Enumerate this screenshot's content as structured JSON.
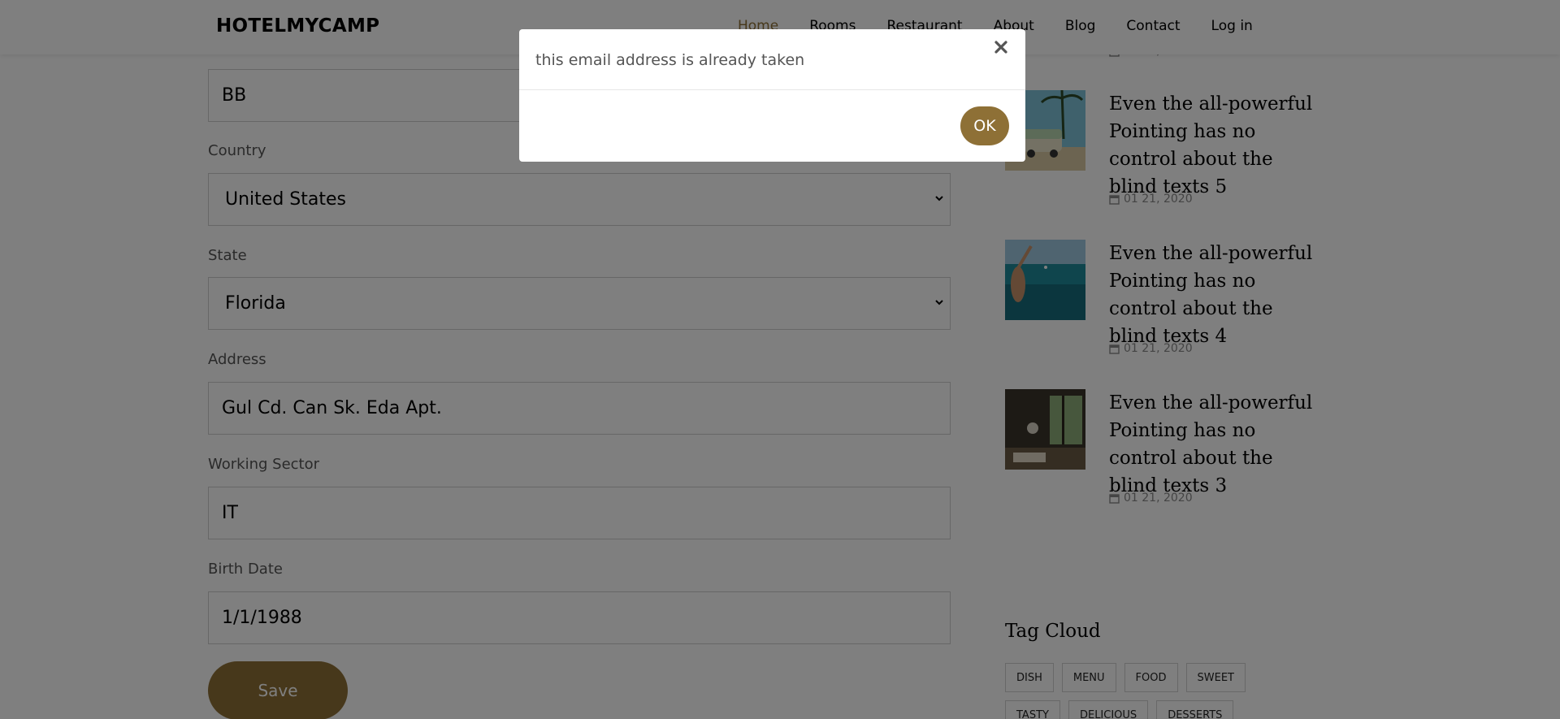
{
  "brand": "HOTELMYCAMP",
  "nav": {
    "items": [
      "Home",
      "Rooms",
      "Restaurant",
      "About",
      "Blog",
      "Contact",
      "Log in"
    ],
    "active": "Home",
    "accent_color": "#8e7036"
  },
  "form": {
    "fields": [
      {
        "label": "",
        "value": "BB",
        "type": "text"
      },
      {
        "label": "Country",
        "value": "United States",
        "type": "select"
      },
      {
        "label": "State",
        "value": "Florida",
        "type": "select"
      },
      {
        "label": "Address",
        "value": "Gul Cd. Can Sk. Eda Apt.",
        "type": "text"
      },
      {
        "label": "Working Sector",
        "value": "IT",
        "type": "text"
      },
      {
        "label": "Birth Date",
        "value": "1/1/1988",
        "type": "text"
      }
    ],
    "save_label": "Save"
  },
  "sidebar": {
    "partial_date": "01 21, 2020",
    "posts": [
      {
        "title": "Even the all-powerful Pointing has no control about the blind texts 5",
        "date": "01 21, 2020",
        "image": "van-on-beach-photo"
      },
      {
        "title": "Even the all-powerful Pointing has no control about the blind texts 4",
        "date": "01 21, 2020",
        "image": "woman-by-sea-photo"
      },
      {
        "title": "Even the all-powerful Pointing has no control about the blind texts 3",
        "date": "01 21, 2020",
        "image": "cozy-interior-photo"
      }
    ],
    "tag_cloud_heading": "Tag Cloud",
    "tags": [
      "DISH",
      "MENU",
      "FOOD",
      "SWEET",
      "TASTY",
      "DELICIOUS",
      "DESSERTS"
    ]
  },
  "modal": {
    "message": "this email address is already taken",
    "ok_label": "OK",
    "close_icon": "close-icon"
  }
}
